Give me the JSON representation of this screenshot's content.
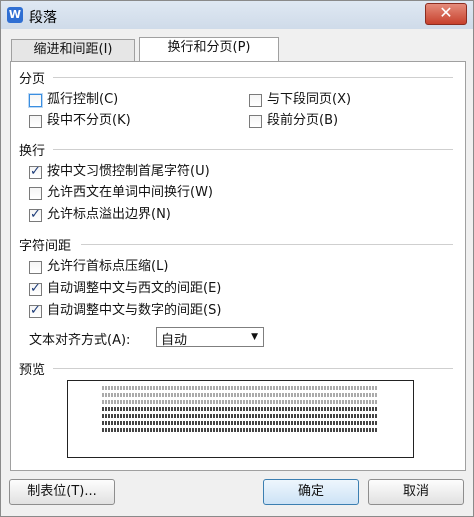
{
  "window": {
    "title": "段落",
    "app_icon": "W",
    "close_label": "✕"
  },
  "tabs": [
    {
      "label": "缩进和间距(I)"
    },
    {
      "label": "换行和分页(P)"
    }
  ],
  "pagination": {
    "title": "分页",
    "items": [
      {
        "label": "孤行控制(C)",
        "checked": false
      },
      {
        "label": "与下段同页(X)",
        "checked": false
      },
      {
        "label": "段中不分页(K)",
        "checked": false
      },
      {
        "label": "段前分页(B)",
        "checked": false
      }
    ]
  },
  "line_break": {
    "title": "换行",
    "items": [
      {
        "label": "按中文习惯控制首尾字符(U)",
        "checked": true
      },
      {
        "label": "允许西文在单词中间换行(W)",
        "checked": false
      },
      {
        "label": "允许标点溢出边界(N)",
        "checked": true
      }
    ]
  },
  "char_spacing": {
    "title": "字符间距",
    "items": [
      {
        "label": "允许行首标点压缩(L)",
        "checked": false
      },
      {
        "label": "自动调整中文与西文的间距(E)",
        "checked": true
      },
      {
        "label": "自动调整中文与数字的间距(S)",
        "checked": true
      }
    ],
    "text_align_label": "文本对齐方式(A):",
    "text_align_value": "自动"
  },
  "preview": {
    "title": "预览"
  },
  "buttons": {
    "tabs": "制表位(T)...",
    "ok": "确定",
    "cancel": "取消"
  }
}
